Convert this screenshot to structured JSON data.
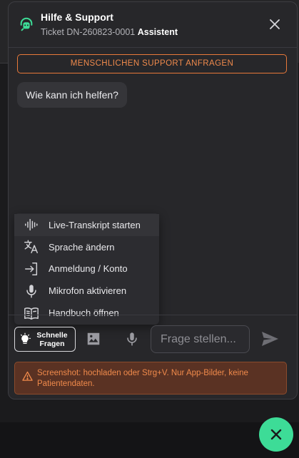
{
  "colors": {
    "accent_green": "#3ddc97",
    "accent_orange": "#e8793a",
    "panel_bg": "#27272a",
    "warning_bg": "#5a3223"
  },
  "header": {
    "logo_icon": "headset-bot-icon",
    "title": "Hilfe & Support",
    "ticket_label": "Ticket DN-260823-0001",
    "mode_label": "Assistent",
    "close_icon": "close-icon"
  },
  "human_support_button": "MENSCHLICHEN SUPPORT ANFRAGEN",
  "messages": [
    {
      "role": "assistant",
      "text": "Wie kann ich helfen?"
    }
  ],
  "quick_menu": {
    "items": [
      {
        "icon": "audio-waveform-icon",
        "label": "Live-Transkript starten"
      },
      {
        "icon": "translate-icon",
        "label": "Sprache ändern"
      },
      {
        "icon": "sign-in-icon",
        "label": "Anmeldung / Konto"
      },
      {
        "icon": "microphone-icon",
        "label": "Mikrofon aktivieren"
      },
      {
        "icon": "book-icon",
        "label": "Handbuch öffnen"
      }
    ],
    "active_index": 0
  },
  "composer": {
    "quick_button_line1": "Schnelle",
    "quick_button_line2": "Fragen",
    "quick_icon": "lightbulb-icon",
    "image_icon": "image-icon",
    "mic_icon": "microphone-icon",
    "placeholder": "Frage stellen...",
    "send_icon": "send-icon"
  },
  "warning": {
    "icon": "warning-triangle-icon",
    "text": "Screenshot: hochladen oder Strg+V. Nur App-Bilder, keine Patientendaten."
  },
  "fab_icon": "close-icon"
}
